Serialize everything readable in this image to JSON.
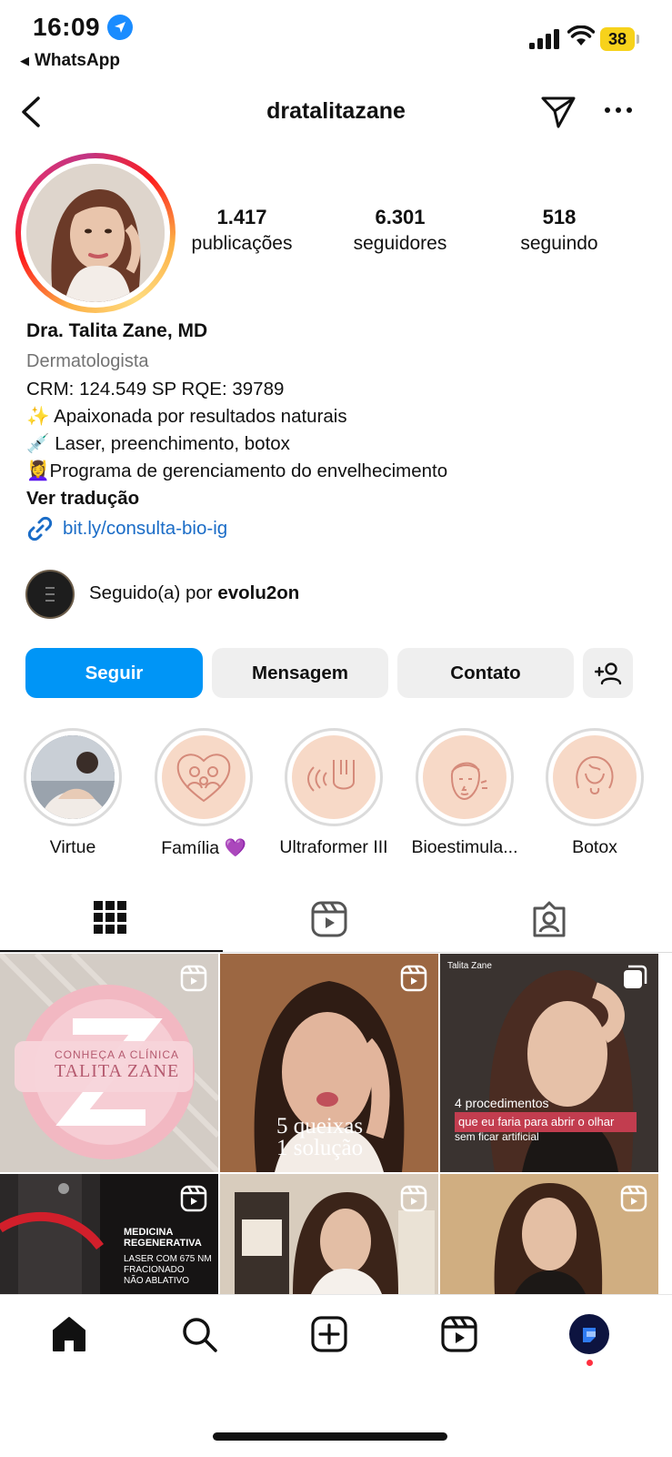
{
  "status_bar": {
    "time": "16:09",
    "back_app": "WhatsApp",
    "battery": "38"
  },
  "header": {
    "username": "dratalitazane"
  },
  "stats": [
    {
      "num": "1.417",
      "label": "publicações"
    },
    {
      "num": "6.301",
      "label": "seguidores"
    },
    {
      "num": "518",
      "label": "seguindo"
    }
  ],
  "profile": {
    "name": "Dra. Talita Zane, MD",
    "category": "Dermatologista",
    "bio": [
      "CRM: 124.549 SP RQE: 39789",
      "✨ Apaixonada por resultados naturais",
      "💉 Laser, preenchimento, botox",
      "💆‍♀️Programa de gerenciamento do envelhecimento"
    ],
    "translate": "Ver tradução",
    "link": "bit.ly/consulta-bio-ig",
    "followed_prefix": "Seguido(a) por ",
    "followed_by": "evolu2on"
  },
  "buttons": {
    "follow": "Seguir",
    "message": "Mensagem",
    "contact": "Contato"
  },
  "highlights": [
    {
      "label": "Virtue",
      "icon": "photo"
    },
    {
      "label": "Família 💜",
      "icon": "heart-family-icon"
    },
    {
      "label": "Ultraformer III",
      "icon": "ultrasound-device-icon"
    },
    {
      "label": "Bioestimula...",
      "icon": "face-icon"
    },
    {
      "label": "Botox",
      "icon": "face-outline-icon"
    }
  ],
  "grid": [
    {
      "text1": "CONHEÇA A CLÍNICA",
      "text2": "TALITA ZANE",
      "badge": "reel"
    },
    {
      "text1": "5 queixas",
      "text2": "1 solução",
      "badge": "reel"
    },
    {
      "text1": "4 procedimentos",
      "text2": "que eu faria para abrir o olhar",
      "text3": "sem ficar artificial",
      "brand": "Talita Zane",
      "badge": "carousel"
    },
    {
      "text1": "MEDICINA",
      "text2": "REGENERATIVA",
      "text3": "LASER COM 675 NM",
      "text4": "FRACIONADO",
      "text5": "NÃO ABLATIVO",
      "badge": "reel"
    },
    {
      "badge": "reel"
    },
    {
      "badge": "reel"
    }
  ],
  "colors": {
    "accent": "#0095f6",
    "link": "#1a6cc7",
    "highlight_bg": "#f7d9c7"
  }
}
